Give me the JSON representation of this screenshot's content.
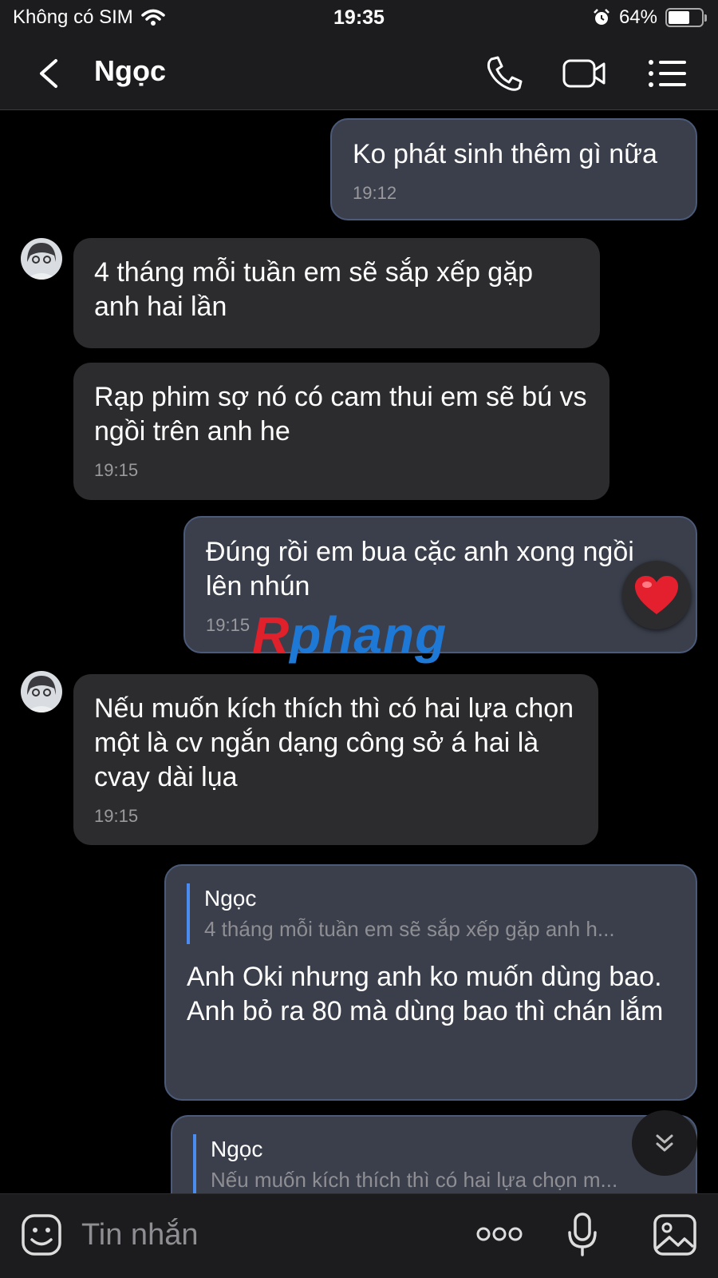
{
  "status_bar": {
    "carrier": "Không có SIM",
    "time": "19:35",
    "battery": "64%",
    "battery_level": 0.64
  },
  "header": {
    "contact_name": "Ngọc",
    "icons": [
      "back-icon",
      "phone-icon",
      "video-icon",
      "menu-icon"
    ]
  },
  "messages": [
    {
      "side": "out",
      "text": "Ko phát sinh thêm gì nữa",
      "time": "19:12"
    },
    {
      "side": "in",
      "text": "4 tháng mỗi tuần em sẽ sắp xếp gặp anh hai lần"
    },
    {
      "side": "in",
      "text": "Rạp phim sợ nó có cam thui em sẽ bú vs ngồi trên anh he",
      "time": "19:15"
    },
    {
      "side": "out",
      "text": "Đúng rồi em bua cặc anh xong ngồi lên nhún",
      "time": "19:15",
      "reaction": "❤️"
    },
    {
      "side": "in",
      "text": "Nếu muốn kích thích thì có hai lựa chọn một là cv ngắn dạng công sở á hai là cvay dài lụa",
      "time": "19:15"
    },
    {
      "side": "out",
      "quote_name": "Ngọc",
      "quote_text": "4 tháng mỗi tuần em sẽ sắp xếp gặp anh h...",
      "text": "Anh Oki nhưng anh ko muốn dùng bao. Anh bỏ ra 80 mà dùng bao thì chán lắm"
    },
    {
      "side": "out",
      "quote_name": "Ngọc",
      "quote_text": "Nếu muốn kích thích thì có hai lựa chọn m..."
    }
  ],
  "watermark": {
    "part1": "R",
    "part2": "phang"
  },
  "composer": {
    "placeholder": "Tin nhắn",
    "icons": [
      "emoji-icon",
      "more-icon",
      "microphone-icon",
      "image-icon"
    ]
  },
  "colors": {
    "incoming_bubble": "#2c2c2e",
    "outgoing_bubble": "#3a3f4b",
    "accent": "#4a8cf0",
    "background": "#000000"
  }
}
